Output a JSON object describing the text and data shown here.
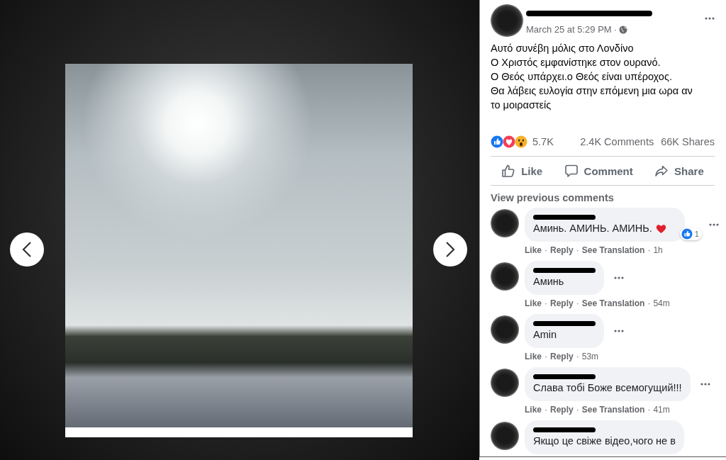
{
  "post": {
    "timestamp": "March 25 at 5:29 PM",
    "separator": "·",
    "text_lines": [
      "Αυτό συνέβη μόλις στο Λονδίνο",
      "Ο Χριστός εμφανίστηκε στον ουρανό.",
      "Ο Θεός υπάρχει.ο Θεός είναι υπέροχος.",
      "Θα λάβεις ευλογία στην επόμενη μια ωρα αν",
      "το μοιραστείς"
    ]
  },
  "stats": {
    "reactions": [
      {
        "kind": "like"
      },
      {
        "kind": "love"
      },
      {
        "kind": "wow"
      }
    ],
    "reaction_count": "5.7K",
    "comments": "2.4K Comments",
    "shares": "66K Shares"
  },
  "actions": [
    {
      "kind": "like",
      "label": "Like"
    },
    {
      "kind": "comment",
      "label": "Comment"
    },
    {
      "kind": "share",
      "label": "Share"
    }
  ],
  "view_previous": "View previous comments",
  "meta_separator": "·",
  "comments": [
    {
      "text": "Аминь. АМИНЬ. АМИНЬ.",
      "emoji": {
        "kind": "heart"
      },
      "reaction_count": "1",
      "links": [
        "Like",
        "Reply",
        "See Translation"
      ],
      "time": "1h"
    },
    {
      "text": "Аминь",
      "links": [
        "Like",
        "Reply",
        "See Translation"
      ],
      "time": "54m"
    },
    {
      "text": "Amin",
      "links": [
        "Like",
        "Reply"
      ],
      "time": "53m"
    },
    {
      "text": "Слава тобі Боже всемогущий!!!",
      "links": [
        "Like",
        "Reply",
        "See Translation"
      ],
      "time": "41m"
    },
    {
      "text": "Якщо це свіже відео,чого не в"
    }
  ]
}
